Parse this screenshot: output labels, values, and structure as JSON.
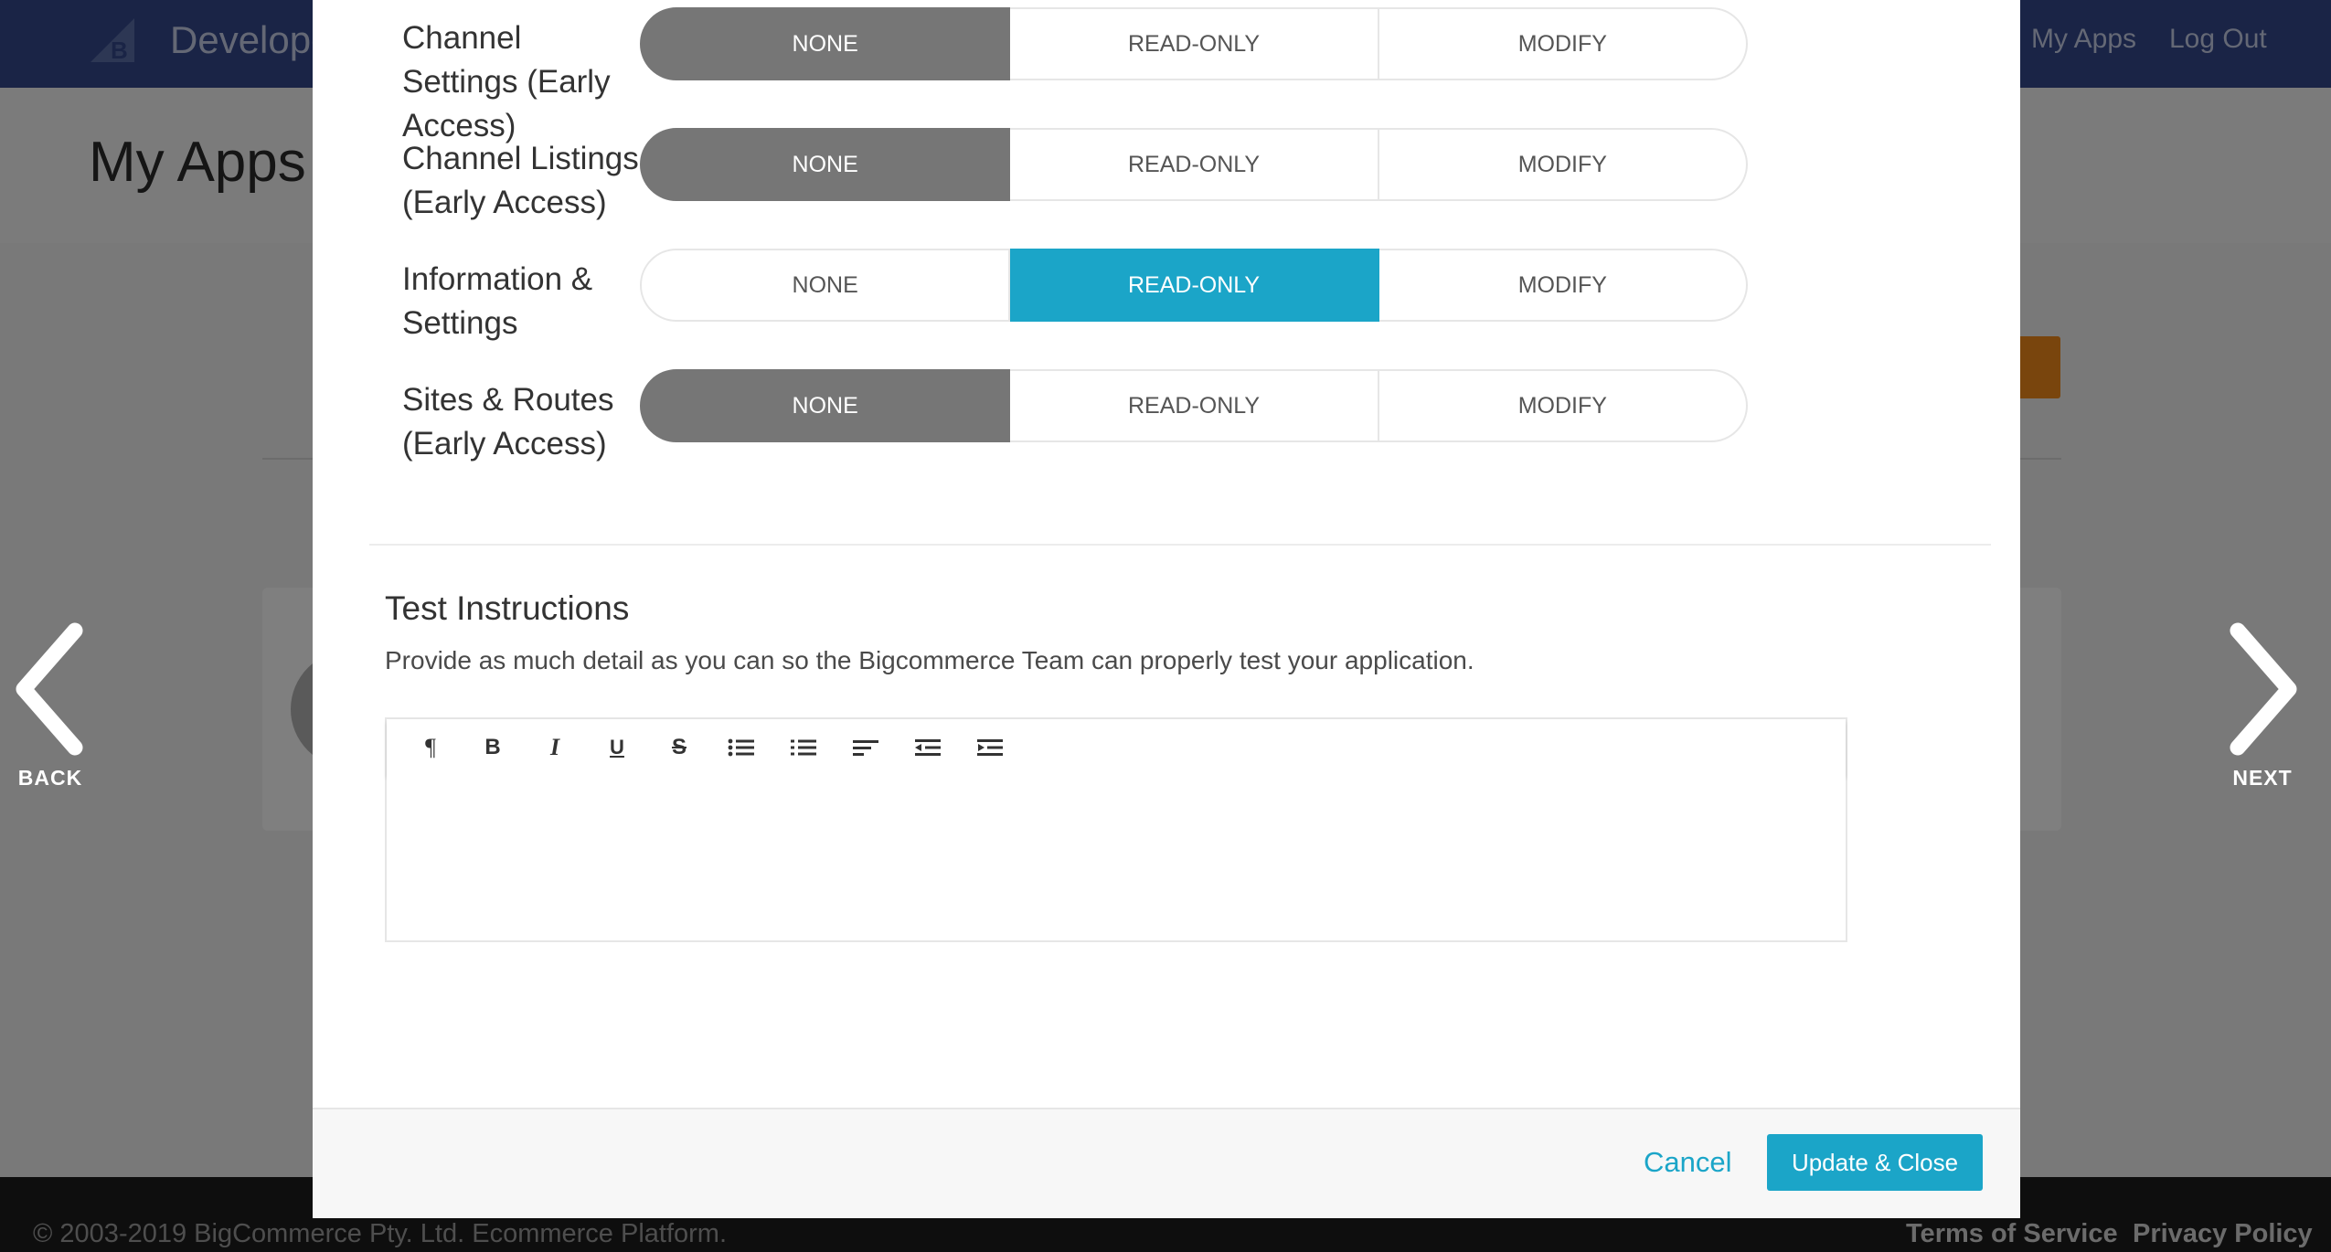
{
  "app": {
    "brand": "Develope",
    "nav": {
      "my_apps": "My Apps",
      "log_out": "Log Out"
    },
    "page_title": "My Apps",
    "footer": {
      "copyright": "© 2003-2019 BigCommerce Pty. Ltd. Ecommerce Platform.",
      "terms": "Terms of Service",
      "privacy": "Privacy Policy"
    }
  },
  "side_nav": {
    "back": "BACK",
    "next": "NEXT"
  },
  "permission_options": {
    "none": "NONE",
    "read_only": "READ-ONLY",
    "modify": "MODIFY"
  },
  "permissions": [
    {
      "label": "Channel Settings (Early Access)",
      "selected": "NONE"
    },
    {
      "label": "Channel Listings (Early Access)",
      "selected": "NONE"
    },
    {
      "label": "Information & Settings",
      "selected": "READ-ONLY"
    },
    {
      "label": "Sites & Routes (Early Access)",
      "selected": "NONE"
    }
  ],
  "test_instructions": {
    "title": "Test Instructions",
    "description": "Provide as much detail as you can so the Bigcommerce Team can properly test your application.",
    "toolbar": {
      "paragraph": "¶",
      "bold": "B",
      "italic": "I",
      "underline": "U",
      "strike": "S"
    },
    "value": ""
  },
  "footer_actions": {
    "cancel": "Cancel",
    "update": "Update & Close"
  },
  "colors": {
    "accent": "#1ba5c8",
    "selected_none": "#767676",
    "header": "#34498c",
    "orange": "#f28a1a"
  }
}
